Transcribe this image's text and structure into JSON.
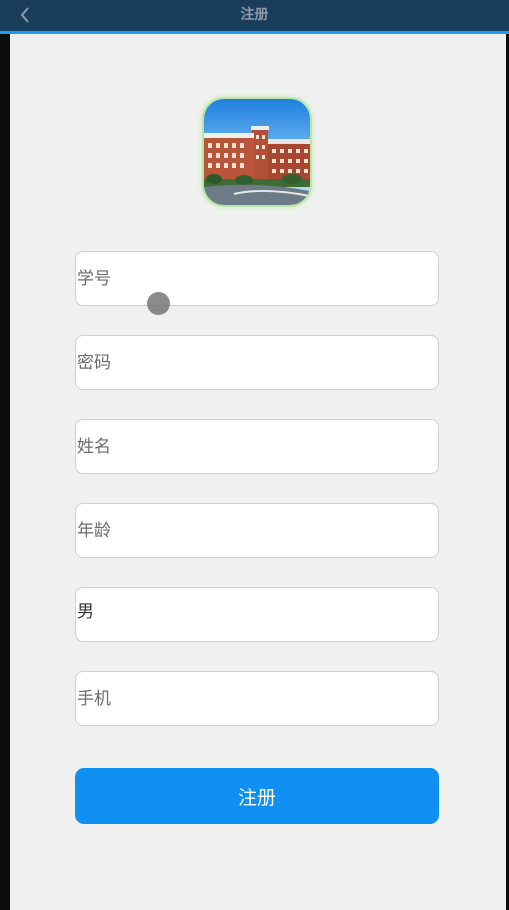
{
  "nav": {
    "title": "注册",
    "back_icon": "chevron-left-icon"
  },
  "logo": {
    "description_icon": "campus-building-image"
  },
  "form": {
    "student_id_placeholder": "学号",
    "password_placeholder": "密码",
    "name_placeholder": "姓名",
    "age_placeholder": "年龄",
    "gender_value": "男",
    "phone_placeholder": "手机"
  },
  "submit_label": "注册",
  "colors": {
    "nav_bg": "#1a3d5c",
    "nav_accent": "#1e9bf0",
    "primary": "#0f8ff2",
    "page_bg": "#f0f0f1"
  }
}
